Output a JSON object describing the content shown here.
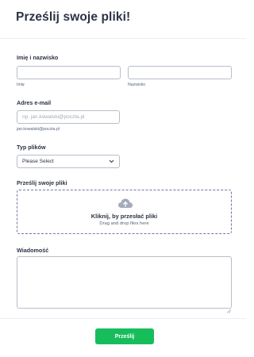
{
  "form": {
    "title": "Prześlij swoje pliki!"
  },
  "name_field": {
    "label": "Imię i nazwisko",
    "first_value": "",
    "first_sublabel": "Imię",
    "last_value": "",
    "last_sublabel": "Nazwisko"
  },
  "email_field": {
    "label": "Adres e-mail",
    "placeholder": "np: jan.kowalski@poczta.pl",
    "sublabel": "jan.kowalski@poczta.pl"
  },
  "file_type": {
    "label": "Typ plików",
    "selected": "Please Select"
  },
  "upload": {
    "label": "Prześlij swoje pliki",
    "title": "Kliknij, by przesłać pliki",
    "subtitle": "Drag and drop files here",
    "icon": "cloud-upload-icon"
  },
  "message": {
    "label": "Wiadomość"
  },
  "submit": {
    "label": "Prześlij"
  },
  "colors": {
    "accent": "#18bd5b",
    "text": "#2c3345",
    "border": "#b8bdc9",
    "dropzone_border": "#6f76a7"
  }
}
